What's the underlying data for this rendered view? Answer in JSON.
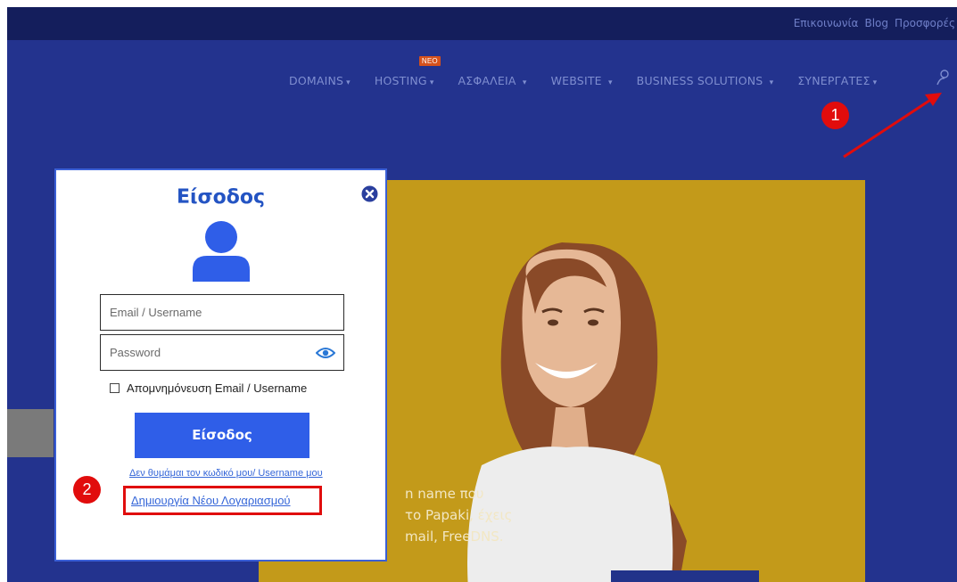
{
  "topbar": {
    "links": [
      "Επικοινωνία",
      "Blog",
      "Προσφορές"
    ]
  },
  "nav": {
    "items": [
      {
        "label": "DOMAINS"
      },
      {
        "label": "HOSTING",
        "badge": "NEO"
      },
      {
        "label": "ΑΣΦΑΛΕΙΑ"
      },
      {
        "label": "WEBSITE"
      },
      {
        "label": "BUSINESS SOLUTIONS"
      },
      {
        "label": "ΣΥΝΕΡΓΑΤΕΣ"
      }
    ],
    "caret": "▾",
    "user_icon": "user-icon"
  },
  "annotations": {
    "step1": "1",
    "step2": "2"
  },
  "hero": {
    "lines": [
      "n name που",
      "το Papaki, έχεις",
      "mail, FreeDNS."
    ]
  },
  "login_modal": {
    "title": "Είσοδος",
    "email_placeholder": "Email / Username",
    "password_placeholder": "Password",
    "remember_label": "Απομνημόνευση Email / Username",
    "submit_label": "Είσοδος",
    "forgot_link": "Δεν θυμάμαι τον κωδικό μου/ Username μου",
    "create_account_link": "Δημιουργία Νέου Λογαριασμού"
  },
  "colors": {
    "nav_bg": "#23338e",
    "topbar_bg": "#141e5c",
    "accent_blue": "#2f5ee8",
    "annotation_red": "#e10c0c",
    "hero_yellow": "#c39a1a"
  }
}
